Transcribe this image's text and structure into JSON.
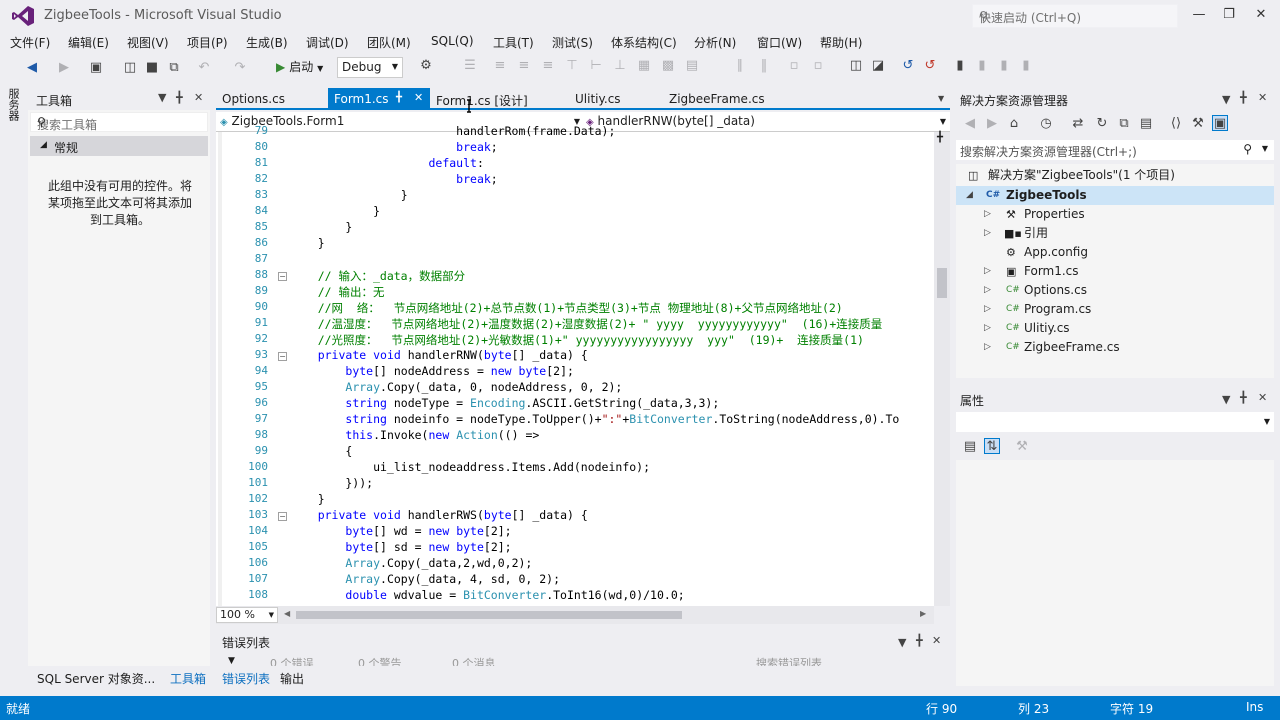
{
  "window": {
    "title": "ZigbeeTools - Microsoft Visual Studio",
    "quick_launch_placeholder": "快速启动 (Ctrl+Q)"
  },
  "menu": [
    "文件(F)",
    "编辑(E)",
    "视图(V)",
    "项目(P)",
    "生成(B)",
    "调试(D)",
    "团队(M)",
    "SQL(Q)",
    "工具(T)",
    "测试(S)",
    "体系结构(C)",
    "分析(N)",
    "窗口(W)",
    "帮助(H)"
  ],
  "toolbar": {
    "start_label": "启动",
    "config_value": "Debug"
  },
  "left_strip": {
    "server_explorer": "服务器资源管理器"
  },
  "toolbox": {
    "title": "工具箱",
    "search_placeholder": "搜索工具箱",
    "group": "常规",
    "empty_message_1": "此组中没有可用的控件。将",
    "empty_message_2": "某项拖至此文本可将其添加",
    "empty_message_3": "到工具箱。"
  },
  "tabs": [
    {
      "label": "Options.cs"
    },
    {
      "label": "Form1.cs"
    },
    {
      "label": "Form1.cs [设计]"
    },
    {
      "label": "Ulitiy.cs"
    },
    {
      "label": "ZigbeeFrame.cs"
    }
  ],
  "navbar": {
    "class_combo": "ZigbeeTools.Form1",
    "member_combo": "handlerRNW(byte[] _data)"
  },
  "editor": {
    "zoom": "100 %",
    "lines": [
      {
        "n": "79",
        "text": "                        handlerRom(frame.Data);"
      },
      {
        "n": "80",
        "text": "                        break;"
      },
      {
        "n": "81",
        "text": "                    default:"
      },
      {
        "n": "82",
        "text": "                        break;"
      },
      {
        "n": "83",
        "text": "                }"
      },
      {
        "n": "84",
        "text": "            }"
      },
      {
        "n": "85",
        "text": "        }"
      },
      {
        "n": "86",
        "text": "    }"
      },
      {
        "n": "87",
        "text": ""
      },
      {
        "n": "88",
        "text": "    // 输入：_data，数据部分"
      },
      {
        "n": "89",
        "text": "    // 输出：无"
      },
      {
        "n": "90",
        "text": "    //网  络：  节点网络地址(2)+总节点数(1)+节点类型(3)+节点 物理地址(8)+父节点网络地址(2)"
      },
      {
        "n": "91",
        "text": "    //温湿度：  节点网络地址(2)+温度数据(2)+湿度数据(2)+ \" yyyy  yyyyyyyyyyyy\"  (16)+连接质量"
      },
      {
        "n": "92",
        "text": "    //光照度：  节点网络地址(2)+光敏数据(1)+\" yyyyyyyyyyyyyyyyy  yyy\"  (19)+  连接质量(1)"
      },
      {
        "n": "93",
        "text": "    private void handlerRNW(byte[] _data) {"
      },
      {
        "n": "94",
        "text": "        byte[] nodeAddress = new byte[2];"
      },
      {
        "n": "95",
        "text": "        Array.Copy(_data, 0, nodeAddress, 0, 2);"
      },
      {
        "n": "96",
        "text": "        string nodeType = Encoding.ASCII.GetString(_data,3,3);"
      },
      {
        "n": "97",
        "text": "        string nodeinfo = nodeType.ToUpper()+\":\"+BitConverter.ToString(nodeAddress,0).To"
      },
      {
        "n": "98",
        "text": "        this.Invoke(new Action(() =>"
      },
      {
        "n": "99",
        "text": "        {"
      },
      {
        "n": "100",
        "text": "            ui_list_nodeaddress.Items.Add(nodeinfo);"
      },
      {
        "n": "101",
        "text": "        }));"
      },
      {
        "n": "102",
        "text": "    }"
      },
      {
        "n": "103",
        "text": "    private void handlerRWS(byte[] _data) {"
      },
      {
        "n": "104",
        "text": "        byte[] wd = new byte[2];"
      },
      {
        "n": "105",
        "text": "        byte[] sd = new byte[2];"
      },
      {
        "n": "106",
        "text": "        Array.Copy(_data,2,wd,0,2);"
      },
      {
        "n": "107",
        "text": "        Array.Copy(_data, 4, sd, 0, 2);"
      },
      {
        "n": "108",
        "text": "        double wdvalue = BitConverter.ToInt16(wd,0)/10.0;"
      }
    ]
  },
  "error_list": {
    "title": "错误列表",
    "errors": "0 个错误",
    "warnings": "0 个警告",
    "messages": "0 个消息",
    "search_placeholder": "搜索错误列表"
  },
  "bottom_tabs": [
    "SQL Server 对象资...",
    "工具箱",
    "错误列表",
    "输出"
  ],
  "solution": {
    "title": "解决方案资源管理器",
    "search_placeholder": "搜索解决方案资源管理器(Ctrl+;)",
    "root": "解决方案\"ZigbeeTools\"(1 个项目)",
    "project": "ZigbeeTools",
    "items": [
      "Properties",
      "引用",
      "App.config",
      "Form1.cs",
      "Options.cs",
      "Program.cs",
      "Ulitiy.cs",
      "ZigbeeFrame.cs"
    ]
  },
  "properties": {
    "title": "属性"
  },
  "status": {
    "ready": "就绪",
    "line": "行 90",
    "col": "列 23",
    "char": "字符 19",
    "mode": "Ins"
  },
  "colors": {
    "accent": "#007acc",
    "keyword": "#0000ff",
    "type": "#2b91af",
    "comment": "#008000",
    "string": "#a31515"
  }
}
